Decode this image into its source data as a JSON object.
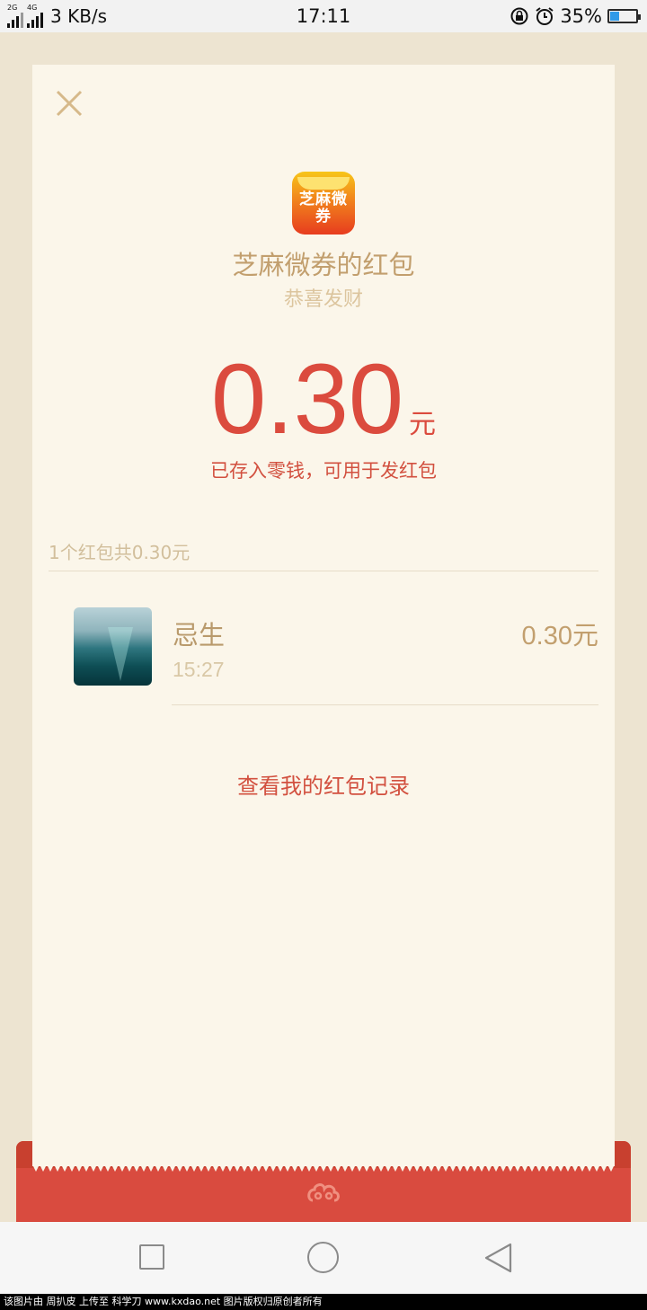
{
  "status_bar": {
    "network_tag_1": "2G",
    "network_tag_2": "4G",
    "speed": "3 KB/s",
    "time": "17:11",
    "battery_percent_label": "35%",
    "battery_level": 0.35,
    "icons": [
      "signal-icon",
      "rotation-lock-icon",
      "alarm-icon",
      "battery-icon"
    ]
  },
  "card": {
    "close_icon": "close-icon",
    "app_logo_text": "芝麻微券",
    "title": "芝麻微券的红包",
    "greeting": "恭喜发财",
    "amount": "0.30",
    "unit": "元",
    "stored_note": "已存入零钱，可用于发红包",
    "summary": "1个红包共0.30元",
    "records": [
      {
        "name": "忌生",
        "time": "15:27",
        "amount": "0.30元"
      }
    ],
    "history_link": "查看我的红包记录"
  },
  "nav_bar": {
    "icons": [
      "recent-apps-icon",
      "home-icon",
      "back-icon"
    ]
  },
  "watermark": "该图片由 周扒皮 上传至 科学刀 www.kxdao.net 图片版权归原创者所有",
  "colors": {
    "background": "#ede4d1",
    "card": "#fbf6ea",
    "accent_red": "#db4b3e",
    "gold_text": "#c29f6e"
  }
}
